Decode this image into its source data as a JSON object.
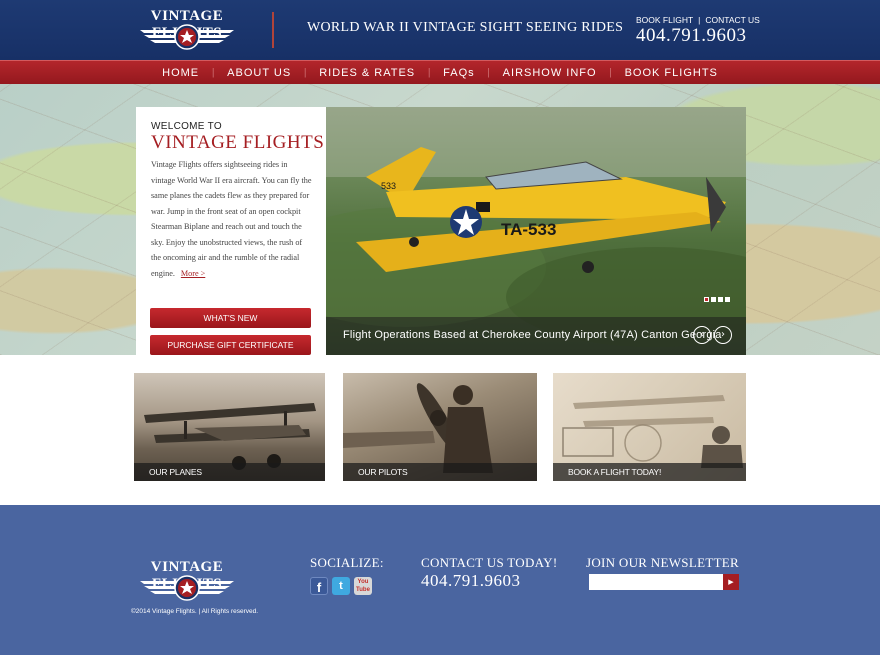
{
  "header": {
    "logo_text": "VINTAGE FLIGHTS",
    "tagline": "WORLD WAR II VINTAGE SIGHT SEEING RIDES",
    "book_flight_link": "BOOK FLIGHT",
    "contact_us_link": "CONTACT US",
    "link_separator": "|",
    "phone": "404.791.9603"
  },
  "nav": {
    "items": [
      {
        "label": "HOME"
      },
      {
        "label": "ABOUT US"
      },
      {
        "label": "RIDES & RATES"
      },
      {
        "label": "FAQs"
      },
      {
        "label": "AIRSHOW INFO"
      },
      {
        "label": "BOOK FLIGHTS"
      }
    ],
    "separator": "|"
  },
  "welcome": {
    "kicker": "WELCOME TO",
    "title": "VINTAGE FLIGHTS",
    "body": "Vintage Flights offers sightseeing rides in vintage World War II era aircraft. You can fly the same planes the cadets flew as they prepared for war. Jump in the front seat of an open cockpit Stearman Biplane and reach out and touch the sky. Enjoy the unobstructed views, the rush of the oncoming air and the rumble of the radial engine.",
    "more_link": "More >",
    "whats_new_button": "WHAT'S NEW",
    "gift_button": "PURCHASE GIFT CERTIFICATE"
  },
  "slider": {
    "caption": "Flight Operations Based at Cherokee County Airport (47A) Canton Georgia",
    "prev_icon": "chevron-left-icon",
    "next_icon": "chevron-right-icon",
    "prev_glyph": "‹",
    "next_glyph": "›",
    "plane_number": "TA-533",
    "plane_tail": "533",
    "slide_count": 4,
    "active_slide": 1
  },
  "tiles": [
    {
      "label": "OUR PLANES"
    },
    {
      "label": "OUR PILOTS"
    },
    {
      "label": "BOOK A FLIGHT TODAY!"
    }
  ],
  "footer": {
    "logo_text": "VINTAGE FLIGHTS",
    "copyright": "©2014 Vintage Flights.  |  All Rights reserved.",
    "socialize_heading": "SOCIALIZE:",
    "contact_heading": "CONTACT US TODAY!",
    "phone": "404.791.9603",
    "newsletter_heading": "JOIN OUR NEWSLETTER",
    "newsletter_placeholder": "",
    "submit_glyph": "▶",
    "social": {
      "facebook": "f",
      "twitter": "t",
      "youtube_line1": "You",
      "youtube_line2": "Tube"
    }
  },
  "colors": {
    "header_blue": "#1e3a73",
    "nav_red": "#a51e22",
    "footer_blue": "#4a65a0",
    "accent_red": "#a51e22",
    "plane_yellow": "#f0c020"
  }
}
